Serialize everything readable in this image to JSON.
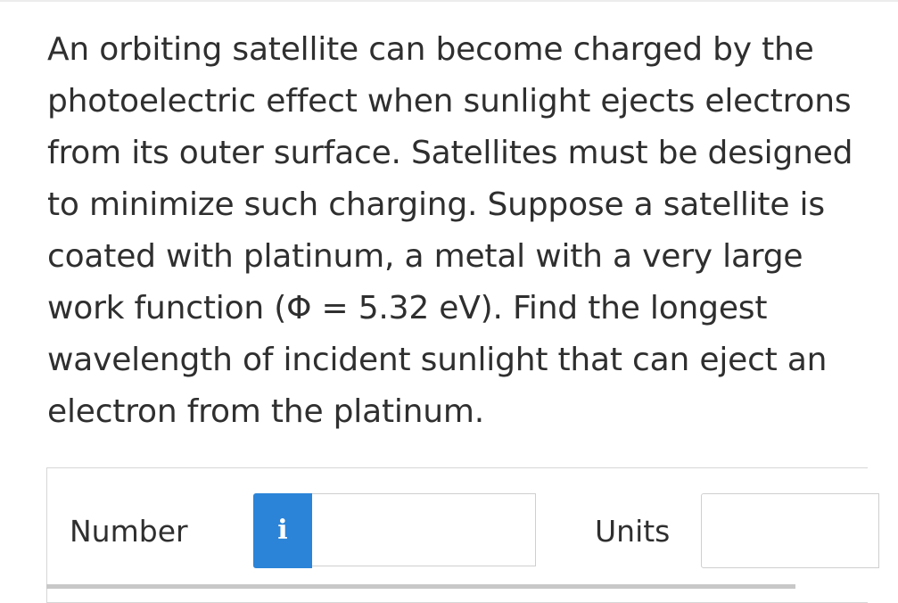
{
  "question": {
    "text": "An orbiting satellite can become charged by the photoelectric effect when sunlight ejects electrons from its outer surface. Satellites must be designed to minimize such charging. Suppose a satellite is coated with platinum, a metal with a very large work function (Φ = 5.32 eV). Find the longest wavelength of incident sunlight that can eject an electron from the platinum."
  },
  "answer": {
    "number_label": "Number",
    "info_icon": "i",
    "number_value": "",
    "units_label": "Units",
    "units_value": ""
  },
  "colors": {
    "accent": "#2b84d8",
    "text": "#2f2f2f",
    "border": "#cfcfcf"
  }
}
